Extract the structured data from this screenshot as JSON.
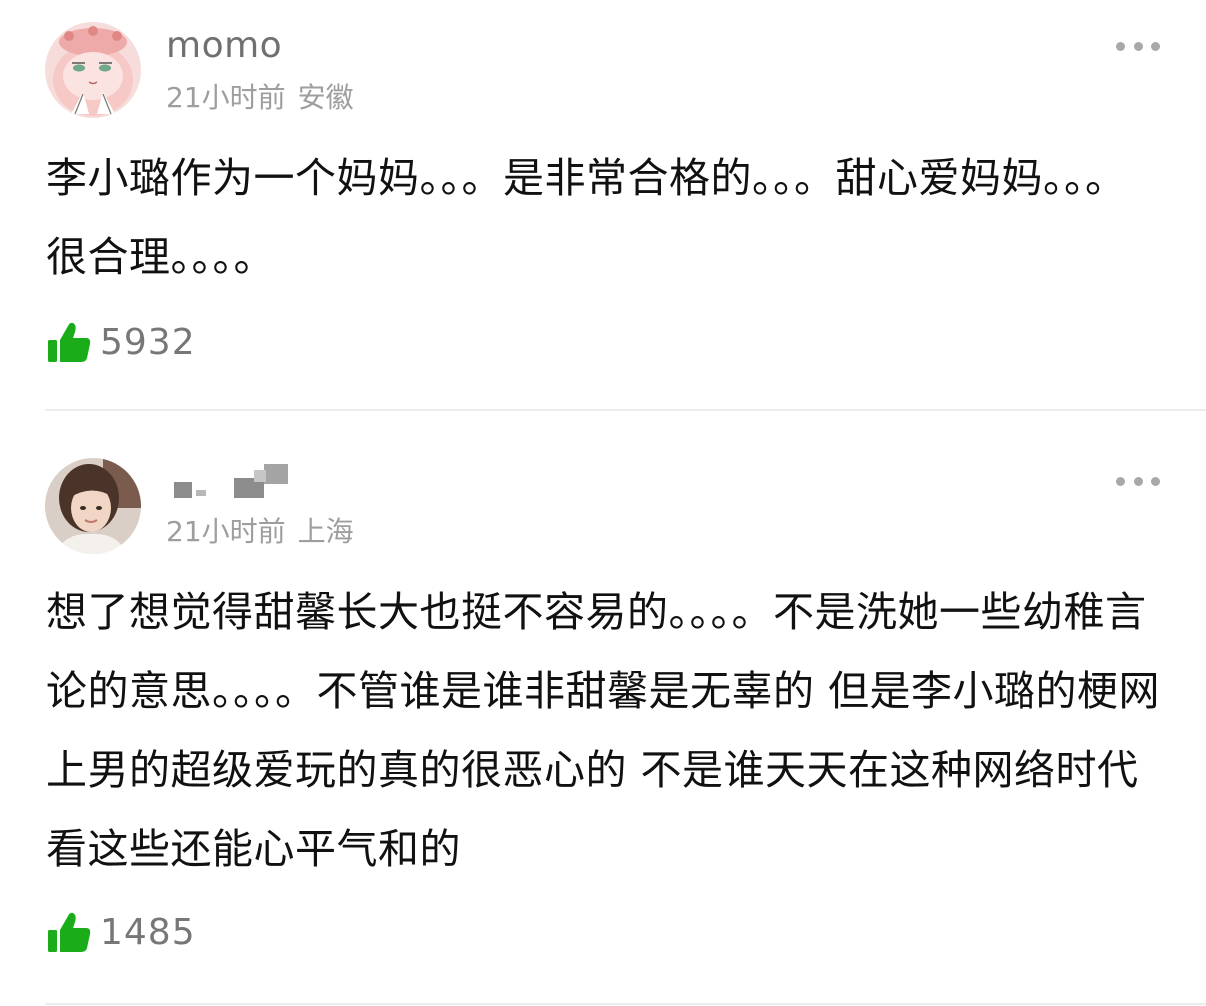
{
  "comments": [
    {
      "username": "momo",
      "time": "21小时前",
      "location": "安徽",
      "text": "李小璐作为一个妈妈。。。是非常合格的。。。甜心爱妈妈。。。很合理。。。。",
      "likes": "5932",
      "avatar_icon": "cartoon-pink-character-avatar",
      "more_icon": "more-dots-icon",
      "like_icon": "thumbs-up-icon"
    },
    {
      "username": "",
      "username_masked": true,
      "time": "21小时前",
      "location": "上海",
      "text": "想了想觉得甜馨长大也挺不容易的。。。。不是洗她一些幼稚言论的意思。。。。不管谁是谁非甜馨是无辜的 但是李小璐的梗网上男的超级爱玩的真的很恶心的 不是谁天天在这种网络时代看这些还能心平气和的",
      "likes": "1485",
      "avatar_icon": "photo-avatar",
      "more_icon": "more-dots-icon",
      "like_icon": "thumbs-up-icon"
    }
  ],
  "colors": {
    "like_green": "#1aad19",
    "meta_gray": "#9e9e9e",
    "text_dark": "#111111"
  }
}
